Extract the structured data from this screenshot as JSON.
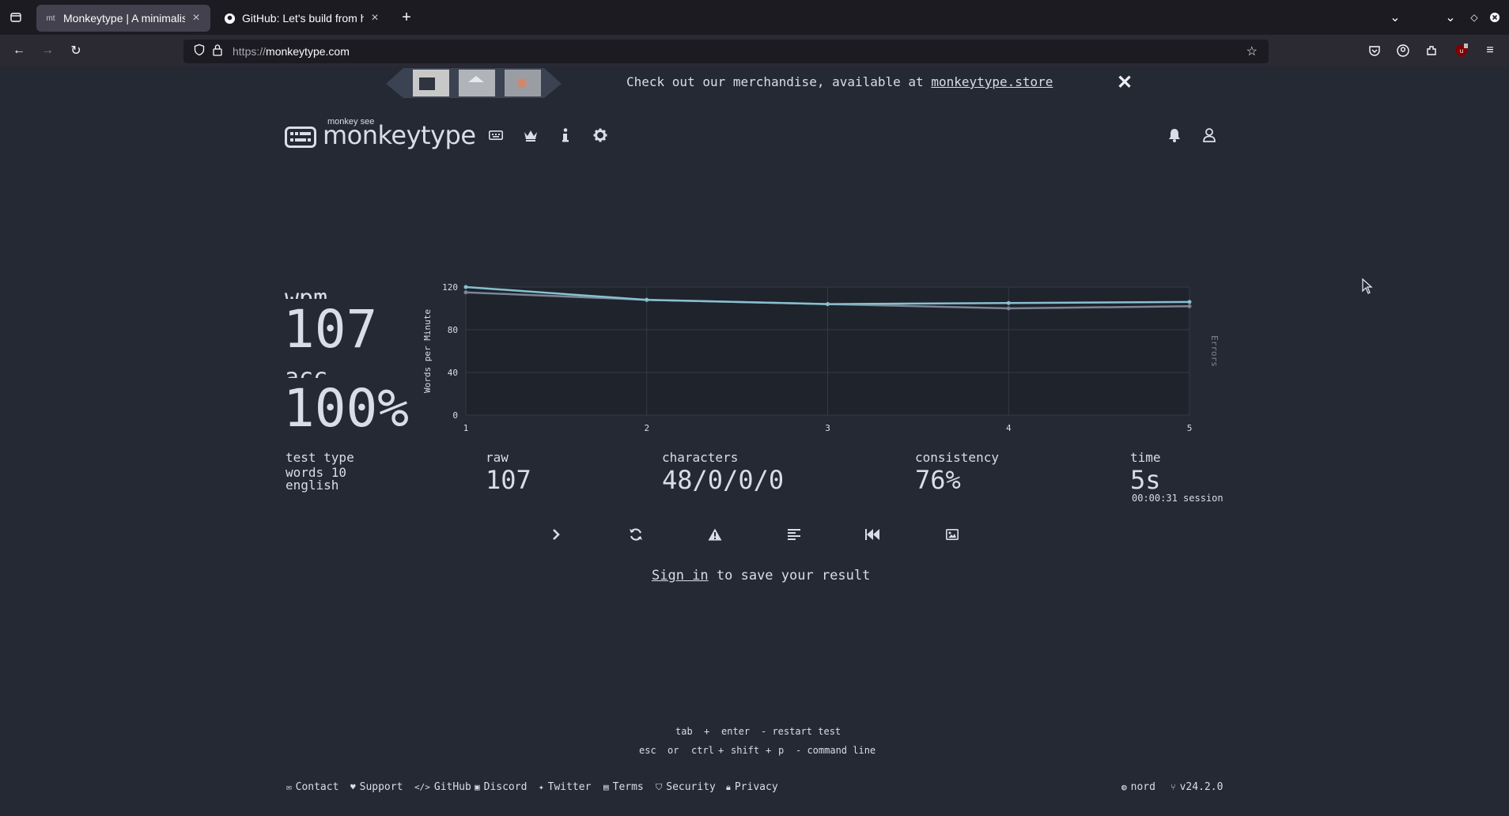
{
  "browser": {
    "tabs": [
      {
        "title": "Monkeytype | A minimalistic",
        "favicon": "mt"
      },
      {
        "title": "GitHub: Let's build from here",
        "favicon": "github-icon"
      }
    ],
    "new_tab": "+",
    "url_proto": "https://",
    "url_host": "monkeytype.com"
  },
  "banner": {
    "text": "Check out our merchandise, available at ",
    "link": "monkeytype.store",
    "close": "✕"
  },
  "header": {
    "logo_top": "monkey see",
    "logo_text": "monkeytype"
  },
  "result": {
    "wpm_label": "wpm",
    "wpm": "107",
    "acc_label": "acc",
    "acc": "100%",
    "test_type_label": "test type",
    "test_type_line1": "words 10",
    "test_type_line2": "english",
    "raw_label": "raw",
    "raw": "107",
    "characters_label": "characters",
    "characters": "48/0/0/0",
    "consistency_label": "consistency",
    "consistency": "76%",
    "time_label": "time",
    "time": "5s",
    "session": "00:00:31 session"
  },
  "chart_data": {
    "type": "line",
    "x": [
      1,
      2,
      3,
      4,
      5
    ],
    "series": [
      {
        "name": "",
        "values": [
          120,
          108,
          104,
          105,
          106
        ],
        "color": "#88c0d0"
      },
      {
        "name": "",
        "values": [
          115,
          108,
          104,
          100,
          102
        ],
        "color": "#7b8596"
      }
    ],
    "ylabel": "Words per Minute",
    "y2label": "Errors",
    "ylim": [
      0,
      120
    ],
    "yticks": [
      0,
      40,
      80,
      120
    ],
    "xticks": [
      1,
      2,
      3,
      4,
      5
    ],
    "grid": true
  },
  "signin": {
    "link": "Sign in",
    "rest": " to save your result"
  },
  "hints": {
    "k_tab": "tab",
    "plus1": "+",
    "k_enter": "enter",
    "restart": "- restart test",
    "k_esc": "esc",
    "or": "or",
    "k_ctrl": "ctrl",
    "plus2": "+",
    "k_shift": "shift",
    "plus3": "+",
    "k_p": "p",
    "cmd": "- command line"
  },
  "footer": {
    "links": [
      "Contact",
      "Support",
      "GitHub",
      "Discord",
      "Twitter",
      "Terms",
      "Security",
      "Privacy"
    ],
    "theme": "nord",
    "version": "v24.2.0"
  },
  "colors": {
    "bg": "#242933",
    "text": "#d8dee9",
    "accent": "#88c0d0"
  }
}
